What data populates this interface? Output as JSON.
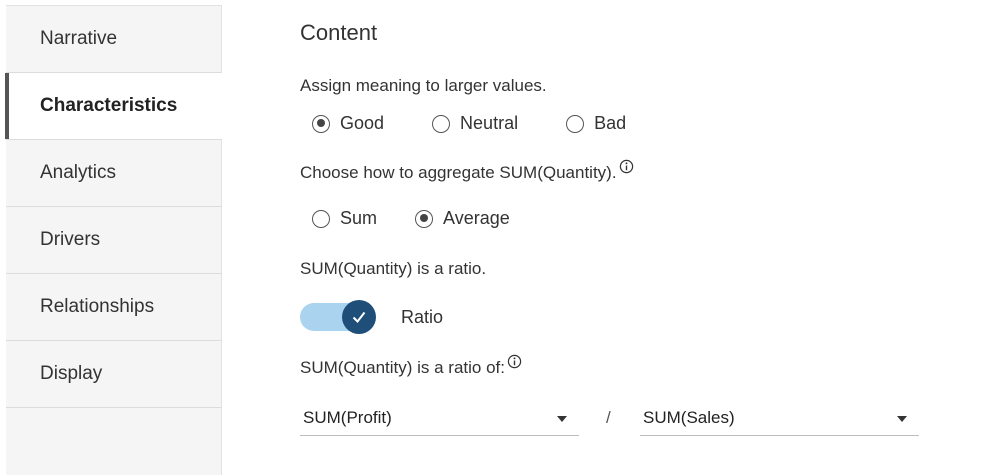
{
  "sidebar": {
    "items": [
      {
        "label": "Narrative"
      },
      {
        "label": "Characteristics"
      },
      {
        "label": "Analytics"
      },
      {
        "label": "Drivers"
      },
      {
        "label": "Relationships"
      },
      {
        "label": "Display"
      }
    ],
    "active": "Characteristics"
  },
  "content": {
    "heading": "Content",
    "meaning": {
      "prompt": "Assign meaning to larger values.",
      "options": [
        "Good",
        "Neutral",
        "Bad"
      ],
      "selected": "Good"
    },
    "aggregate": {
      "prompt": "Choose how to aggregate SUM(Quantity).",
      "info_icon": "info-icon",
      "options": [
        "Sum",
        "Average"
      ],
      "selected": "Average"
    },
    "ratio": {
      "prompt": "SUM(Quantity) is a ratio.",
      "toggle_label": "Ratio",
      "toggle_on": true,
      "track_color": "#a9d3ee",
      "knob_color": "#1f4e79"
    },
    "ratio_of": {
      "prompt": "SUM(Quantity) is a ratio of:",
      "info_icon": "info-icon",
      "numerator": "SUM(Profit)",
      "separator": "/",
      "denominator": "SUM(Sales)"
    }
  }
}
